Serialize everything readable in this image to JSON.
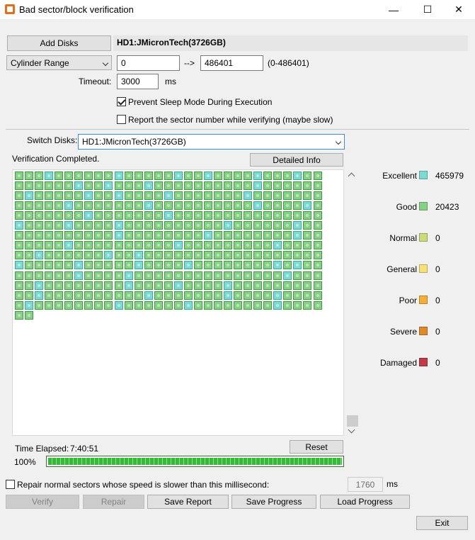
{
  "window": {
    "title": "Bad sector/block verification",
    "minimize_glyph": "—",
    "maximize_glyph": "☐",
    "close_glyph": "✕"
  },
  "disk": {
    "add_button": "Add Disks",
    "selected_name": "HD1:JMicronTech(3726GB)"
  },
  "range": {
    "mode": "Cylinder Range",
    "start": "0",
    "arrow": "-->",
    "end": "486401",
    "hint": "(0-486401)"
  },
  "timeout": {
    "label": "Timeout:",
    "value": "3000",
    "unit": "ms"
  },
  "options": {
    "prevent_sleep": {
      "label": "Prevent Sleep Mode During Execution",
      "checked": true
    },
    "report_sector": {
      "label": "Report the sector number while verifying (maybe slow)",
      "checked": false
    }
  },
  "switch": {
    "label": "Switch Disks:",
    "value": "HD1:JMicronTech(3726GB)"
  },
  "status": {
    "text": "Verification Completed.",
    "detailed_button": "Detailed Info"
  },
  "grid": {
    "total_blocks": 436,
    "excellent_blocks": [
      3,
      10,
      16,
      19,
      24,
      28,
      37,
      40,
      44,
      55,
      63,
      69,
      72,
      77,
      85,
      98,
      106,
      117,
      122,
      131,
      139,
      155,
      160,
      165,
      176,
      183,
      196,
      205,
      214,
      222,
      233,
      243,
      250,
      257,
      260,
      279,
      285,
      291,
      296,
      305,
      307,
      316,
      321,
      337,
      343,
      352,
      357,
      362,
      374,
      385,
      393,
      398,
      404,
      413,
      420,
      429
    ]
  },
  "legend": [
    {
      "label": "Excellent",
      "value": "465979",
      "color": "#7ddad1"
    },
    {
      "label": "Good",
      "value": "20423",
      "color": "#88d088"
    },
    {
      "label": "Normal",
      "value": "0",
      "color": "#c8dc78"
    },
    {
      "label": "General",
      "value": "0",
      "color": "#f6e27a"
    },
    {
      "label": "Poor",
      "value": "0",
      "color": "#f2b136"
    },
    {
      "label": "Severe",
      "value": "0",
      "color": "#e0892a"
    },
    {
      "label": "Damaged",
      "value": "0",
      "color": "#c03a4a"
    }
  ],
  "elapsed": {
    "label": "Time Elapsed:",
    "value": "7:40:51",
    "reset_button": "Reset"
  },
  "progress": {
    "percent_label": "100%",
    "fraction": 1.0
  },
  "repair_option": {
    "label": "Repair normal sectors whose speed is slower than this millisecond:",
    "checked": false,
    "value": "1760",
    "unit": "ms"
  },
  "actions": {
    "verify": "Verify",
    "repair": "Repair",
    "save_report": "Save Report",
    "save_progress": "Save Progress",
    "load_progress": "Load Progress",
    "exit": "Exit"
  }
}
